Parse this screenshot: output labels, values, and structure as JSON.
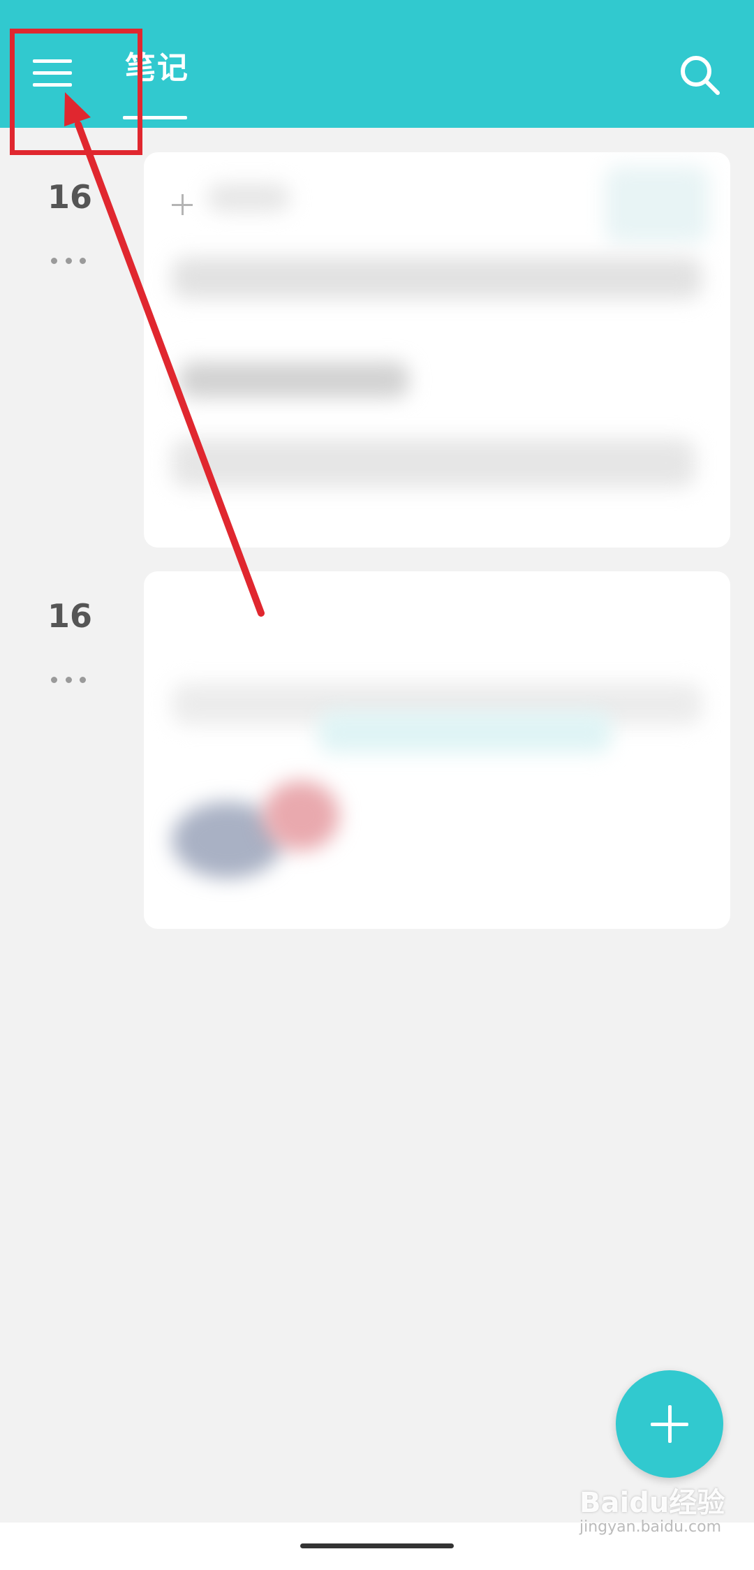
{
  "header": {
    "tab_label": "笔记",
    "accent_color": "#31c9cf",
    "menu_icon": "hamburger-menu-icon",
    "search_icon": "search-icon"
  },
  "notes": [
    {
      "day": "16",
      "more_icon": "ellipsis-icon"
    },
    {
      "day": "16",
      "more_icon": "ellipsis-icon"
    }
  ],
  "fab": {
    "icon": "plus-icon"
  },
  "watermark": {
    "brand": "Baidu经验",
    "url": "jingyan.baidu.com"
  },
  "annotation": {
    "color": "#e0272f"
  }
}
